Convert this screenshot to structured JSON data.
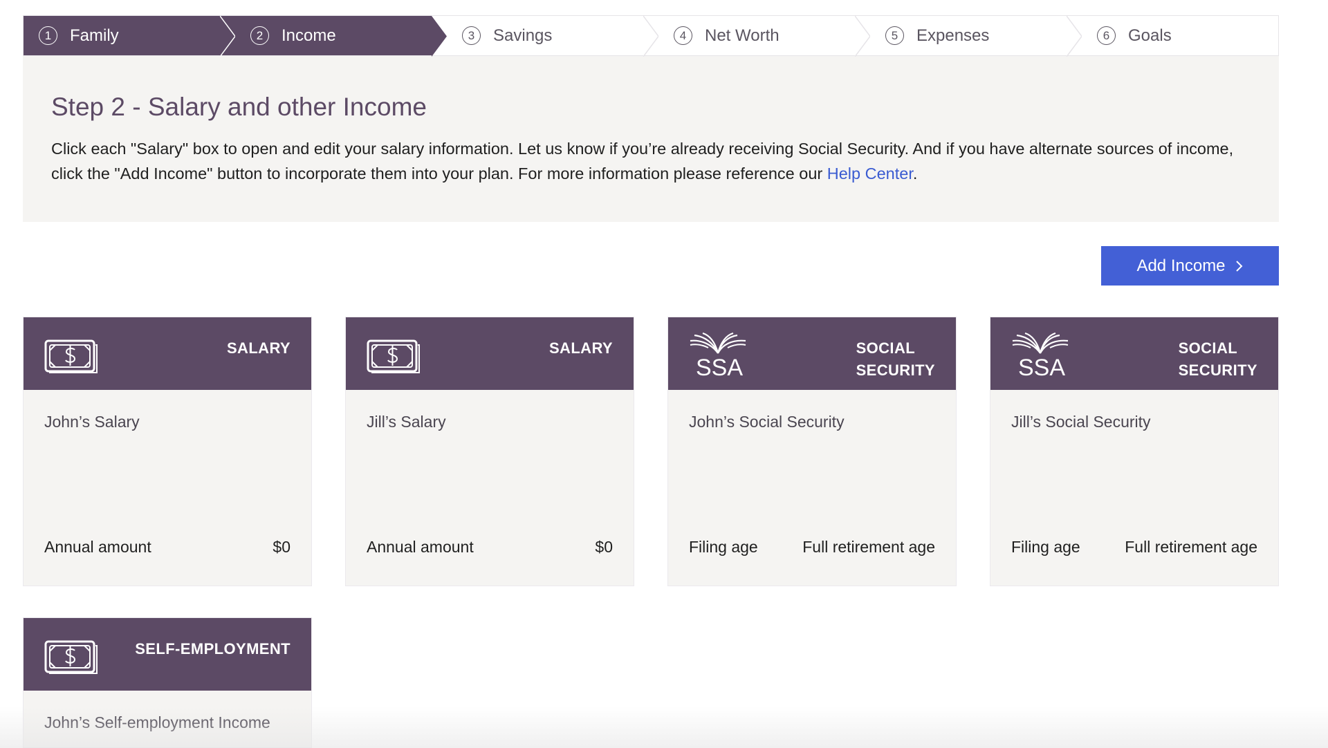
{
  "stepper": {
    "steps": [
      {
        "num": "1",
        "label": "Family",
        "done": true
      },
      {
        "num": "2",
        "label": "Income",
        "done": true
      },
      {
        "num": "3",
        "label": "Savings",
        "done": false
      },
      {
        "num": "4",
        "label": "Net Worth",
        "done": false
      },
      {
        "num": "5",
        "label": "Expenses",
        "done": false
      },
      {
        "num": "6",
        "label": "Goals",
        "done": false
      }
    ]
  },
  "intro": {
    "title": "Step 2 - Salary and other Income",
    "text_before_link": "Click each \"Salary\" box to open and edit your salary information. Let us know if you’re already receiving Social Security. And if you have alternate sources of income, click the \"Add Income\" button to incorporate them into your plan. For more information please reference our ",
    "link_text": "Help Center",
    "text_after_link": "."
  },
  "add_income_button": {
    "label": "Add Income"
  },
  "cards": [
    {
      "type_label": "SALARY",
      "icon": "money-icon",
      "title": "John’s Salary",
      "foot_left": "Annual amount",
      "foot_right": "$0"
    },
    {
      "type_label": "SALARY",
      "icon": "money-icon",
      "title": "Jill’s Salary",
      "foot_left": "Annual amount",
      "foot_right": "$0"
    },
    {
      "type_label_line1": "SOCIAL",
      "type_label_line2": "SECURITY",
      "icon": "ssa-logo",
      "icon_text": "SSA",
      "title": "John’s Social Security",
      "foot_left": "Filing age",
      "foot_right": "Full retirement age"
    },
    {
      "type_label_line1": "SOCIAL",
      "type_label_line2": "SECURITY",
      "icon": "ssa-logo",
      "icon_text": "SSA",
      "title": "Jill’s Social Security",
      "foot_left": "Filing age",
      "foot_right": "Full retirement age"
    },
    {
      "type_label": "SELF-EMPLOYMENT",
      "icon": "money-icon",
      "title": "John’s Self-employment Income"
    }
  ],
  "colors": {
    "brand_purple": "#5c4a65",
    "button_blue": "#4360d6",
    "link_blue": "#3a5bd1",
    "panel_bg": "#f5f4f2"
  }
}
